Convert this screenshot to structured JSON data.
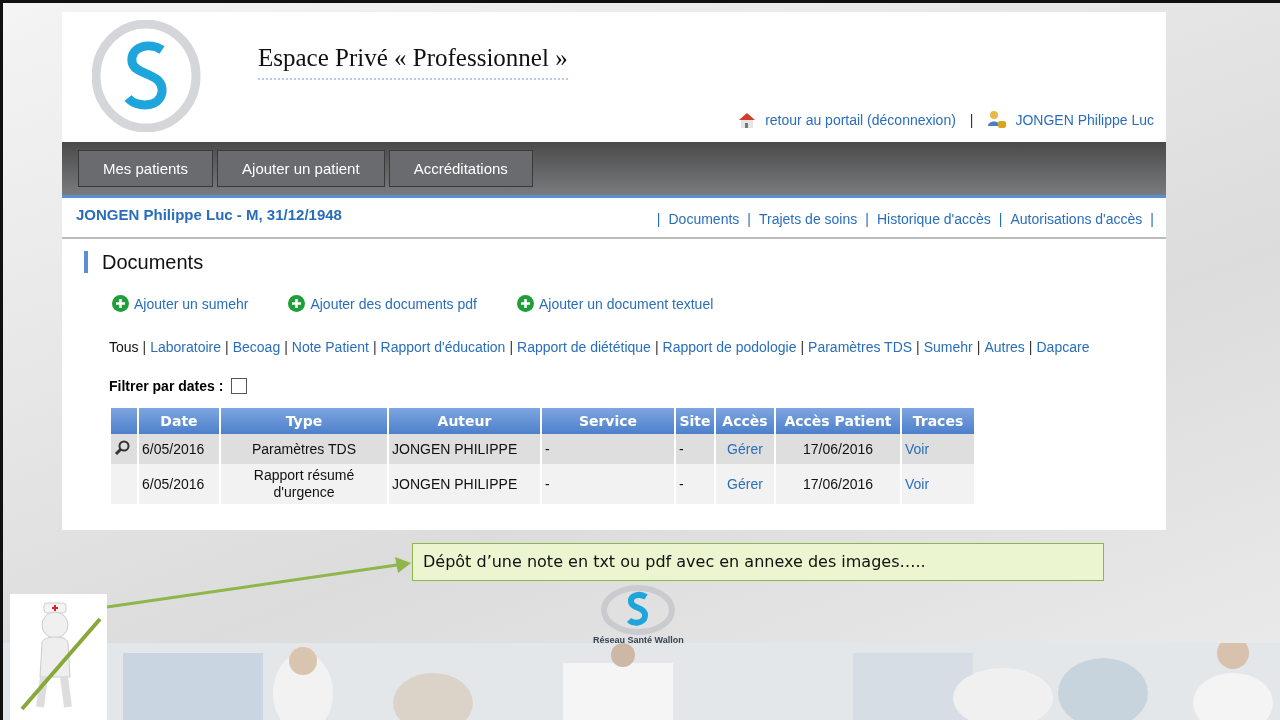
{
  "header": {
    "title": "Espace Privé « Professionnel »",
    "portal_link": "retour au portail (déconnexion)",
    "separator": "|",
    "user_name": "JONGEN Philippe Luc"
  },
  "nav": {
    "tabs": [
      {
        "label": "Mes patients"
      },
      {
        "label": "Ajouter un patient"
      },
      {
        "label": "Accréditations"
      }
    ]
  },
  "patient": {
    "title": "JONGEN Philippe Luc - M, 31/12/1948",
    "lead_separator": "|",
    "links": [
      {
        "label": "Documents",
        "separator": "|"
      },
      {
        "label": "Trajets de soins",
        "separator": "|"
      },
      {
        "label": "Historique d'accès",
        "separator": "|"
      },
      {
        "label": "Autorisations d'accès",
        "separator": "|"
      }
    ]
  },
  "section_title": "Documents",
  "add_actions": [
    "Ajouter un sumehr",
    "Ajouter des documents pdf",
    "Ajouter un document textuel"
  ],
  "filters": [
    {
      "label": "Tous",
      "selected": true,
      "separator": "|"
    },
    {
      "label": "Laboratoire",
      "selected": false,
      "separator": "|"
    },
    {
      "label": "Becoag",
      "selected": false,
      "separator": "|"
    },
    {
      "label": "Note Patient",
      "selected": false,
      "separator": "|"
    },
    {
      "label": "Rapport d'éducation",
      "selected": false,
      "separator": "|"
    },
    {
      "label": "Rapport de diététique",
      "selected": false,
      "separator": "|"
    },
    {
      "label": "Rapport de podologie",
      "selected": false,
      "separator": "|"
    },
    {
      "label": "Paramètres TDS",
      "selected": false,
      "separator": "|"
    },
    {
      "label": "Sumehr",
      "selected": false,
      "separator": "|"
    },
    {
      "label": "Autres",
      "selected": false,
      "separator": "|"
    },
    {
      "label": "Dapcare",
      "selected": false
    }
  ],
  "date_filter": {
    "label": "Filtrer par dates :",
    "checked": false
  },
  "table": {
    "columns": [
      "Date",
      "Type",
      "Auteur",
      "Service",
      "Site",
      "Accès",
      "Accès Patient",
      "Traces"
    ],
    "rows": [
      {
        "preview": true,
        "date": "6/05/2016",
        "type": "Paramètres TDS",
        "author": "JONGEN PHILIPPE",
        "service": "-",
        "site": "-",
        "access": "Gérer",
        "patient_access": "17/06/2016",
        "traces": "Voir"
      },
      {
        "preview": false,
        "date": "6/05/2016",
        "type": "Rapport résumé d'urgence",
        "author": "JONGEN PHILIPPE",
        "service": "-",
        "site": "-",
        "access": "Gérer",
        "patient_access": "17/06/2016",
        "traces": "Voir"
      }
    ]
  },
  "callout": "Dépôt d’une note en txt ou pdf avec en annexe des images…..",
  "footer_logo_caption": "Réseau Santé Wallon"
}
